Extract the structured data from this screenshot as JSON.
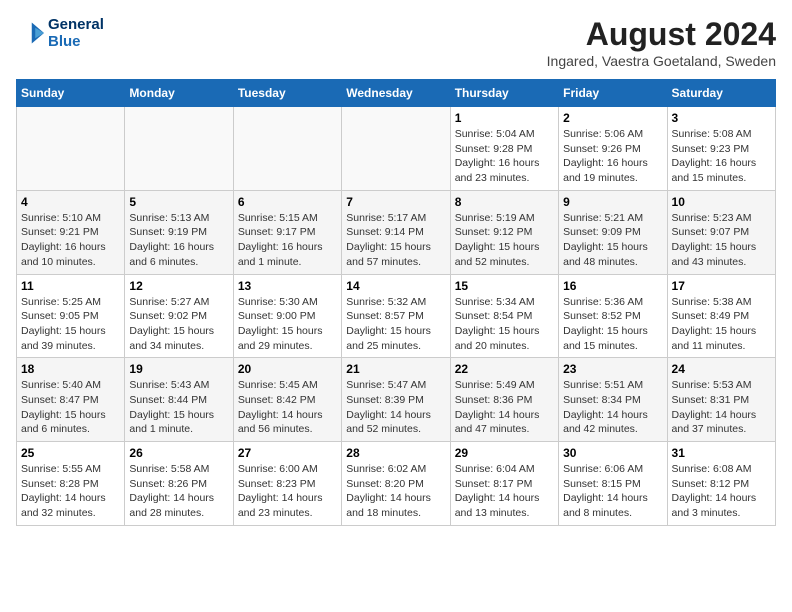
{
  "header": {
    "logo_line1": "General",
    "logo_line2": "Blue",
    "month": "August 2024",
    "location": "Ingared, Vaestra Goetaland, Sweden"
  },
  "weekdays": [
    "Sunday",
    "Monday",
    "Tuesday",
    "Wednesday",
    "Thursday",
    "Friday",
    "Saturday"
  ],
  "weeks": [
    [
      {
        "day": "",
        "info": ""
      },
      {
        "day": "",
        "info": ""
      },
      {
        "day": "",
        "info": ""
      },
      {
        "day": "",
        "info": ""
      },
      {
        "day": "1",
        "info": "Sunrise: 5:04 AM\nSunset: 9:28 PM\nDaylight: 16 hours\nand 23 minutes."
      },
      {
        "day": "2",
        "info": "Sunrise: 5:06 AM\nSunset: 9:26 PM\nDaylight: 16 hours\nand 19 minutes."
      },
      {
        "day": "3",
        "info": "Sunrise: 5:08 AM\nSunset: 9:23 PM\nDaylight: 16 hours\nand 15 minutes."
      }
    ],
    [
      {
        "day": "4",
        "info": "Sunrise: 5:10 AM\nSunset: 9:21 PM\nDaylight: 16 hours\nand 10 minutes."
      },
      {
        "day": "5",
        "info": "Sunrise: 5:13 AM\nSunset: 9:19 PM\nDaylight: 16 hours\nand 6 minutes."
      },
      {
        "day": "6",
        "info": "Sunrise: 5:15 AM\nSunset: 9:17 PM\nDaylight: 16 hours\nand 1 minute."
      },
      {
        "day": "7",
        "info": "Sunrise: 5:17 AM\nSunset: 9:14 PM\nDaylight: 15 hours\nand 57 minutes."
      },
      {
        "day": "8",
        "info": "Sunrise: 5:19 AM\nSunset: 9:12 PM\nDaylight: 15 hours\nand 52 minutes."
      },
      {
        "day": "9",
        "info": "Sunrise: 5:21 AM\nSunset: 9:09 PM\nDaylight: 15 hours\nand 48 minutes."
      },
      {
        "day": "10",
        "info": "Sunrise: 5:23 AM\nSunset: 9:07 PM\nDaylight: 15 hours\nand 43 minutes."
      }
    ],
    [
      {
        "day": "11",
        "info": "Sunrise: 5:25 AM\nSunset: 9:05 PM\nDaylight: 15 hours\nand 39 minutes."
      },
      {
        "day": "12",
        "info": "Sunrise: 5:27 AM\nSunset: 9:02 PM\nDaylight: 15 hours\nand 34 minutes."
      },
      {
        "day": "13",
        "info": "Sunrise: 5:30 AM\nSunset: 9:00 PM\nDaylight: 15 hours\nand 29 minutes."
      },
      {
        "day": "14",
        "info": "Sunrise: 5:32 AM\nSunset: 8:57 PM\nDaylight: 15 hours\nand 25 minutes."
      },
      {
        "day": "15",
        "info": "Sunrise: 5:34 AM\nSunset: 8:54 PM\nDaylight: 15 hours\nand 20 minutes."
      },
      {
        "day": "16",
        "info": "Sunrise: 5:36 AM\nSunset: 8:52 PM\nDaylight: 15 hours\nand 15 minutes."
      },
      {
        "day": "17",
        "info": "Sunrise: 5:38 AM\nSunset: 8:49 PM\nDaylight: 15 hours\nand 11 minutes."
      }
    ],
    [
      {
        "day": "18",
        "info": "Sunrise: 5:40 AM\nSunset: 8:47 PM\nDaylight: 15 hours\nand 6 minutes."
      },
      {
        "day": "19",
        "info": "Sunrise: 5:43 AM\nSunset: 8:44 PM\nDaylight: 15 hours\nand 1 minute."
      },
      {
        "day": "20",
        "info": "Sunrise: 5:45 AM\nSunset: 8:42 PM\nDaylight: 14 hours\nand 56 minutes."
      },
      {
        "day": "21",
        "info": "Sunrise: 5:47 AM\nSunset: 8:39 PM\nDaylight: 14 hours\nand 52 minutes."
      },
      {
        "day": "22",
        "info": "Sunrise: 5:49 AM\nSunset: 8:36 PM\nDaylight: 14 hours\nand 47 minutes."
      },
      {
        "day": "23",
        "info": "Sunrise: 5:51 AM\nSunset: 8:34 PM\nDaylight: 14 hours\nand 42 minutes."
      },
      {
        "day": "24",
        "info": "Sunrise: 5:53 AM\nSunset: 8:31 PM\nDaylight: 14 hours\nand 37 minutes."
      }
    ],
    [
      {
        "day": "25",
        "info": "Sunrise: 5:55 AM\nSunset: 8:28 PM\nDaylight: 14 hours\nand 32 minutes."
      },
      {
        "day": "26",
        "info": "Sunrise: 5:58 AM\nSunset: 8:26 PM\nDaylight: 14 hours\nand 28 minutes."
      },
      {
        "day": "27",
        "info": "Sunrise: 6:00 AM\nSunset: 8:23 PM\nDaylight: 14 hours\nand 23 minutes."
      },
      {
        "day": "28",
        "info": "Sunrise: 6:02 AM\nSunset: 8:20 PM\nDaylight: 14 hours\nand 18 minutes."
      },
      {
        "day": "29",
        "info": "Sunrise: 6:04 AM\nSunset: 8:17 PM\nDaylight: 14 hours\nand 13 minutes."
      },
      {
        "day": "30",
        "info": "Sunrise: 6:06 AM\nSunset: 8:15 PM\nDaylight: 14 hours\nand 8 minutes."
      },
      {
        "day": "31",
        "info": "Sunrise: 6:08 AM\nSunset: 8:12 PM\nDaylight: 14 hours\nand 3 minutes."
      }
    ]
  ]
}
